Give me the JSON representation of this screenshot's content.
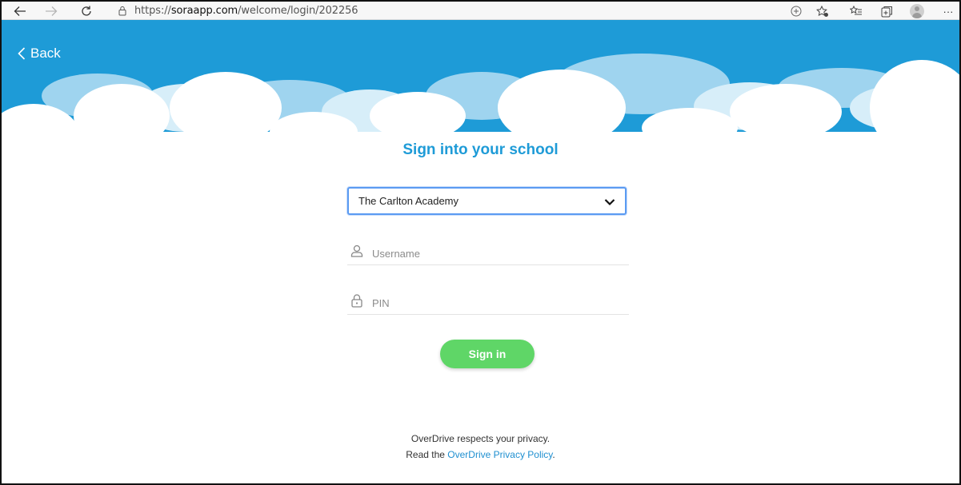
{
  "browser": {
    "url_prefix": "https://",
    "url_host": "soraapp.com",
    "url_path": "/welcome/login/202256",
    "icons": [
      "back-arrow-icon",
      "forward-arrow-icon",
      "refresh-icon",
      "lock-icon",
      "zoom-plus-icon",
      "favorite-star-icon",
      "favorites-list-icon",
      "collections-icon",
      "profile-avatar-icon",
      "more-menu-icon"
    ]
  },
  "header": {
    "back_label": "Back"
  },
  "form": {
    "title": "Sign into your school",
    "school_selected": "The Carlton Academy",
    "username_placeholder": "Username",
    "pin_placeholder": "PIN",
    "signin_label": "Sign in"
  },
  "footer": {
    "line1": "OverDrive respects your privacy.",
    "line2_prefix": "Read the ",
    "policy_link": "OverDrive Privacy Policy",
    "line2_suffix": "."
  },
  "colors": {
    "sky": "#1e9bd7",
    "title": "#1e9bd7",
    "button": "#5fd667",
    "focus": "#5b9bf2",
    "link": "#1e8fd0"
  }
}
